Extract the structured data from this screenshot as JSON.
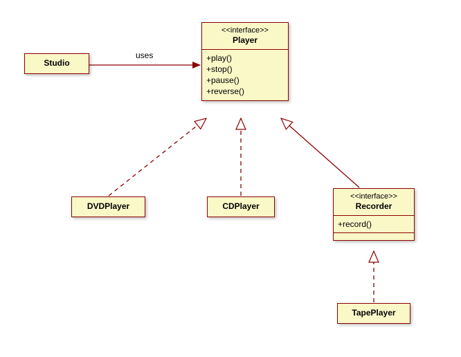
{
  "diagram": {
    "studio": {
      "name": "Studio"
    },
    "player": {
      "stereotype": "<<interface>>",
      "name": "Player",
      "ops": [
        "+play()",
        "+stop()",
        "+pause()",
        "+reverse()"
      ]
    },
    "dvd": {
      "name": "DVDPlayer"
    },
    "cd": {
      "name": "CDPlayer"
    },
    "recorder": {
      "stereotype": "<<interface>>",
      "name": "Recorder",
      "ops": [
        "+record()"
      ]
    },
    "tape": {
      "name": "TapePlayer"
    },
    "edges": {
      "uses": "uses"
    }
  }
}
